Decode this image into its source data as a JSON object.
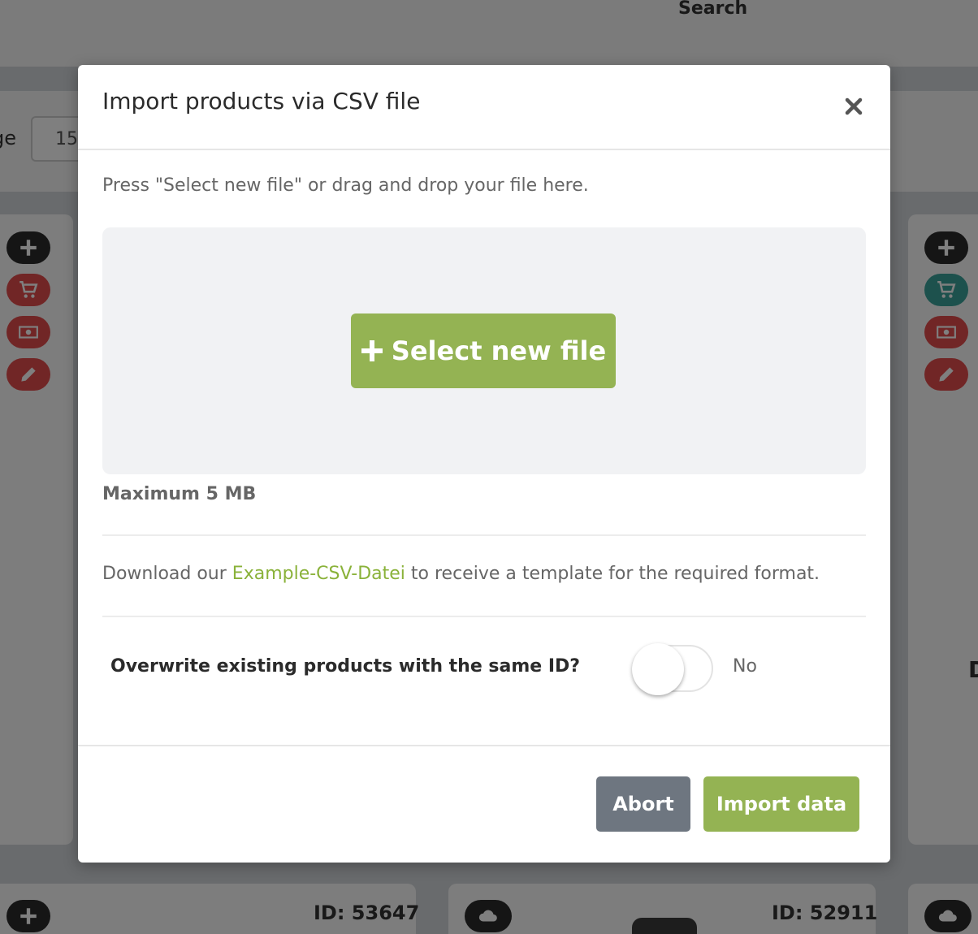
{
  "background": {
    "search_label": "Search",
    "page_label": "ge",
    "page_input_value": "15",
    "edge_letter": "D",
    "cards": [
      {
        "id_label": "ID: 53647"
      },
      {
        "id_label": "ID: 52911"
      }
    ]
  },
  "modal": {
    "title": "Import products via CSV file",
    "instruction": "Press \"Select new file\" or drag and drop your file here.",
    "select_button_label": "Select new file",
    "max_size": "Maximum 5 MB",
    "download_prefix": "Download our ",
    "download_link_label": "Example-CSV-Datei",
    "download_suffix": " to receive a template for the required format.",
    "overwrite_label": "Overwrite existing products with the same ID?",
    "overwrite_state": "No",
    "overwrite_enabled": false,
    "abort_label": "Abort",
    "import_label": "Import data"
  },
  "colors": {
    "primary_green": "#94b353",
    "link_green": "#8ab23a",
    "abort_gray": "#6e7680",
    "action_red": "#e24c4c",
    "action_teal": "#3aa39a",
    "action_dark": "#2b2b2b"
  },
  "icons": {
    "close": "close-icon",
    "plus": "plus-icon",
    "cart": "cart-icon",
    "money": "money-icon",
    "pencil": "pencil-icon",
    "cloud": "cloud-icon"
  }
}
